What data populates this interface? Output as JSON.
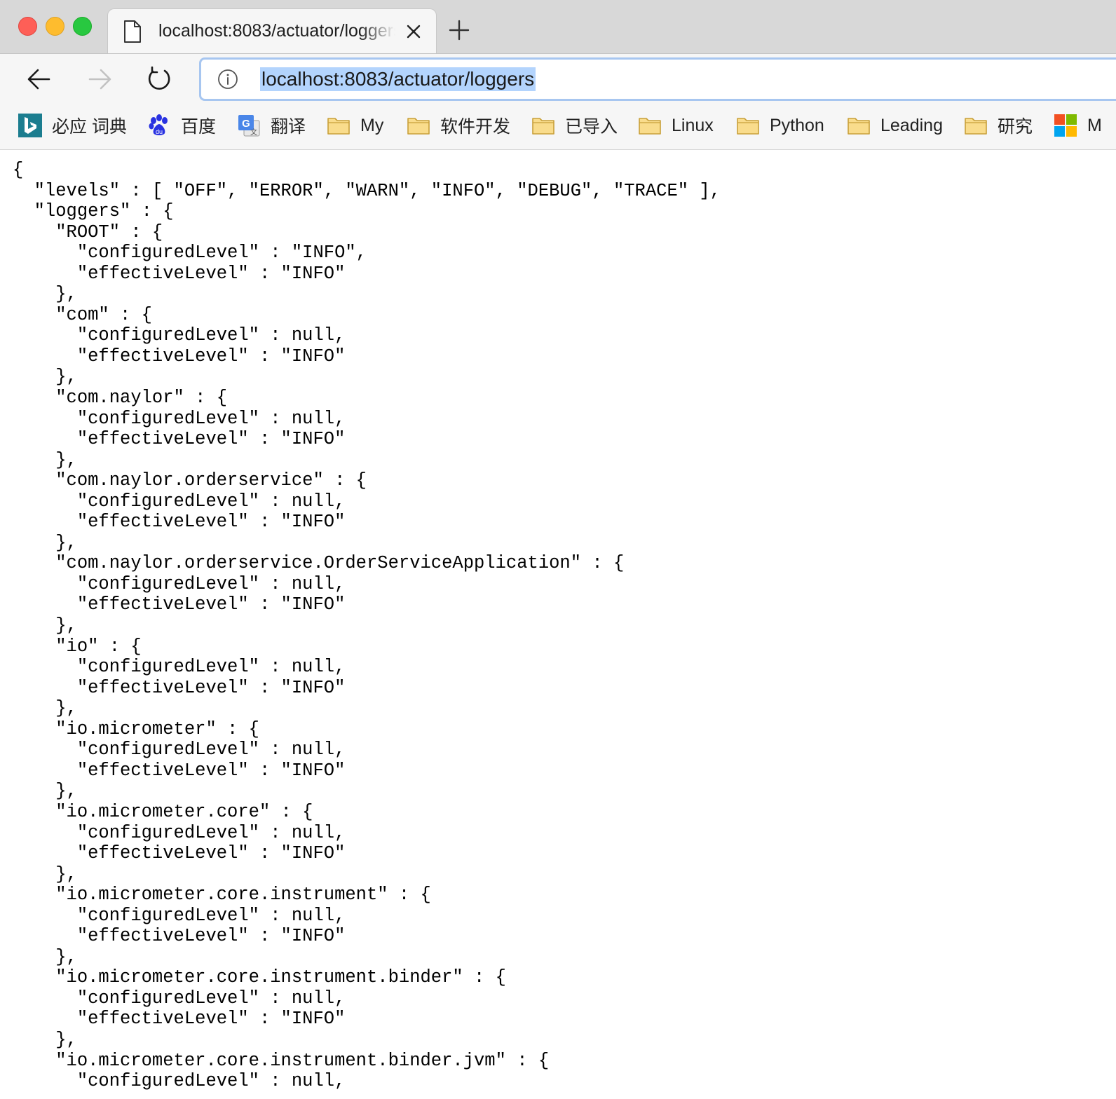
{
  "window": {
    "tab_title": "localhost:8083/actuator/loggers",
    "url": "localhost:8083/actuator/loggers"
  },
  "bookmarks": [
    {
      "label": "必应 词典",
      "icon": "bing-icon"
    },
    {
      "label": "百度",
      "icon": "baidu-paw-icon"
    },
    {
      "label": "翻译",
      "icon": "google-translate-icon"
    },
    {
      "label": "My",
      "icon": "folder-icon"
    },
    {
      "label": "软件开发",
      "icon": "folder-icon"
    },
    {
      "label": "已导入",
      "icon": "folder-icon"
    },
    {
      "label": "Linux",
      "icon": "folder-icon"
    },
    {
      "label": "Python",
      "icon": "folder-icon"
    },
    {
      "label": "Leading",
      "icon": "folder-icon"
    },
    {
      "label": "研究",
      "icon": "folder-icon"
    },
    {
      "label": "M",
      "icon": "microsoft-icon"
    }
  ],
  "colors": {
    "url_highlight": "#b3d4fd",
    "omnibox_focus_border": "#a7c6f0",
    "folder_fill": "#f9dc8c",
    "folder_stroke": "#c8a03a"
  },
  "json_lines": [
    "{",
    "  \"levels\" : [ \"OFF\", \"ERROR\", \"WARN\", \"INFO\", \"DEBUG\", \"TRACE\" ],",
    "  \"loggers\" : {",
    "    \"ROOT\" : {",
    "      \"configuredLevel\" : \"INFO\",",
    "      \"effectiveLevel\" : \"INFO\"",
    "    },",
    "    \"com\" : {",
    "      \"configuredLevel\" : null,",
    "      \"effectiveLevel\" : \"INFO\"",
    "    },",
    "    \"com.naylor\" : {",
    "      \"configuredLevel\" : null,",
    "      \"effectiveLevel\" : \"INFO\"",
    "    },",
    "    \"com.naylor.orderservice\" : {",
    "      \"configuredLevel\" : null,",
    "      \"effectiveLevel\" : \"INFO\"",
    "    },",
    "    \"com.naylor.orderservice.OrderServiceApplication\" : {",
    "      \"configuredLevel\" : null,",
    "      \"effectiveLevel\" : \"INFO\"",
    "    },",
    "    \"io\" : {",
    "      \"configuredLevel\" : null,",
    "      \"effectiveLevel\" : \"INFO\"",
    "    },",
    "    \"io.micrometer\" : {",
    "      \"configuredLevel\" : null,",
    "      \"effectiveLevel\" : \"INFO\"",
    "    },",
    "    \"io.micrometer.core\" : {",
    "      \"configuredLevel\" : null,",
    "      \"effectiveLevel\" : \"INFO\"",
    "    },",
    "    \"io.micrometer.core.instrument\" : {",
    "      \"configuredLevel\" : null,",
    "      \"effectiveLevel\" : \"INFO\"",
    "    },",
    "    \"io.micrometer.core.instrument.binder\" : {",
    "      \"configuredLevel\" : null,",
    "      \"effectiveLevel\" : \"INFO\"",
    "    },",
    "    \"io.micrometer.core.instrument.binder.jvm\" : {",
    "      \"configuredLevel\" : null,"
  ]
}
